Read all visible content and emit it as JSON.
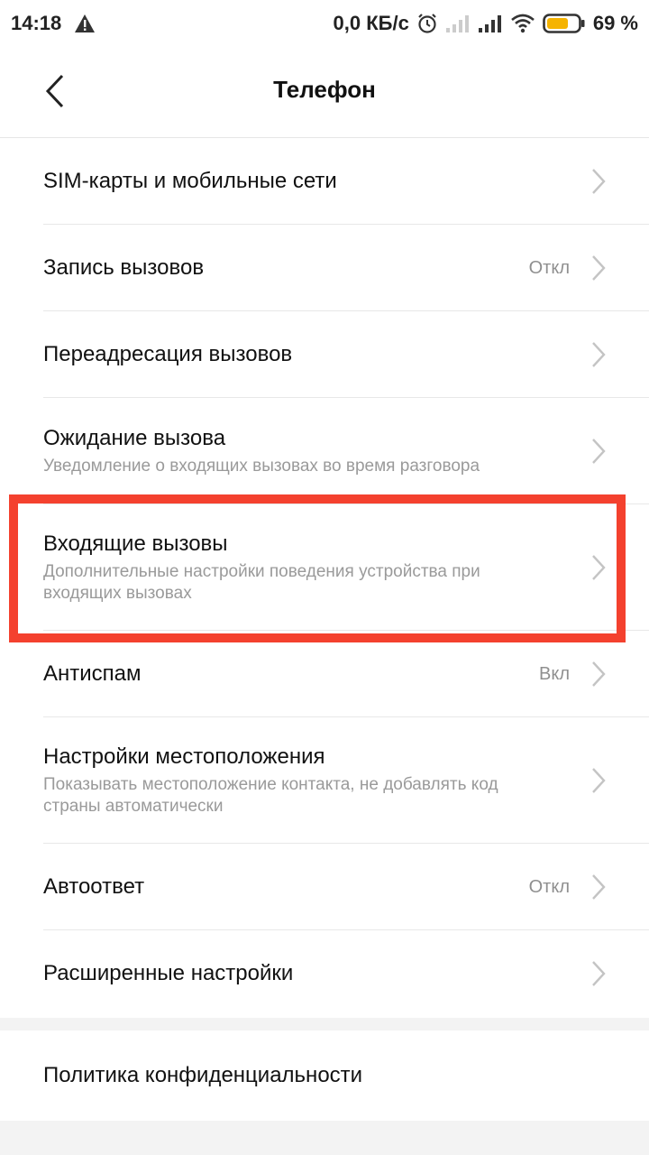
{
  "status_bar": {
    "time": "14:18",
    "speed": "0,0 КБ/с",
    "battery_percent": "69 %",
    "battery_level": 0.69,
    "battery_color": "#f5b300",
    "icons": [
      "warning-icon",
      "alarm-icon",
      "signal-weak-icon",
      "signal-icon",
      "wifi-icon",
      "battery-icon"
    ]
  },
  "header": {
    "title": "Телефон",
    "back_icon": "chevron-left-icon"
  },
  "items": [
    {
      "label": "SIM-карты и мобильные сети"
    },
    {
      "label": "Запись вызовов",
      "value": "Откл"
    },
    {
      "label": "Переадресация вызовов"
    },
    {
      "label": "Ожидание вызова",
      "sub": "Уведомление о входящих вызовах во время разговора"
    },
    {
      "label": "Входящие вызовы",
      "sub": "Дополнительные настройки поведения устройства при входящих вызовах"
    },
    {
      "label": "Антиспам",
      "value": "Вкл"
    },
    {
      "label": "Настройки местоположения",
      "sub": "Показывать местоположение контакта, не добавлять код страны автоматически"
    },
    {
      "label": "Автоответ",
      "value": "Откл"
    },
    {
      "label": "Расширенные настройки"
    }
  ],
  "privacy": {
    "label": "Политика конфиденциальности"
  },
  "colors": {
    "highlight": "#f4412e",
    "secondary_text": "#9a9a9a",
    "chevron": "#c4c4c4"
  }
}
